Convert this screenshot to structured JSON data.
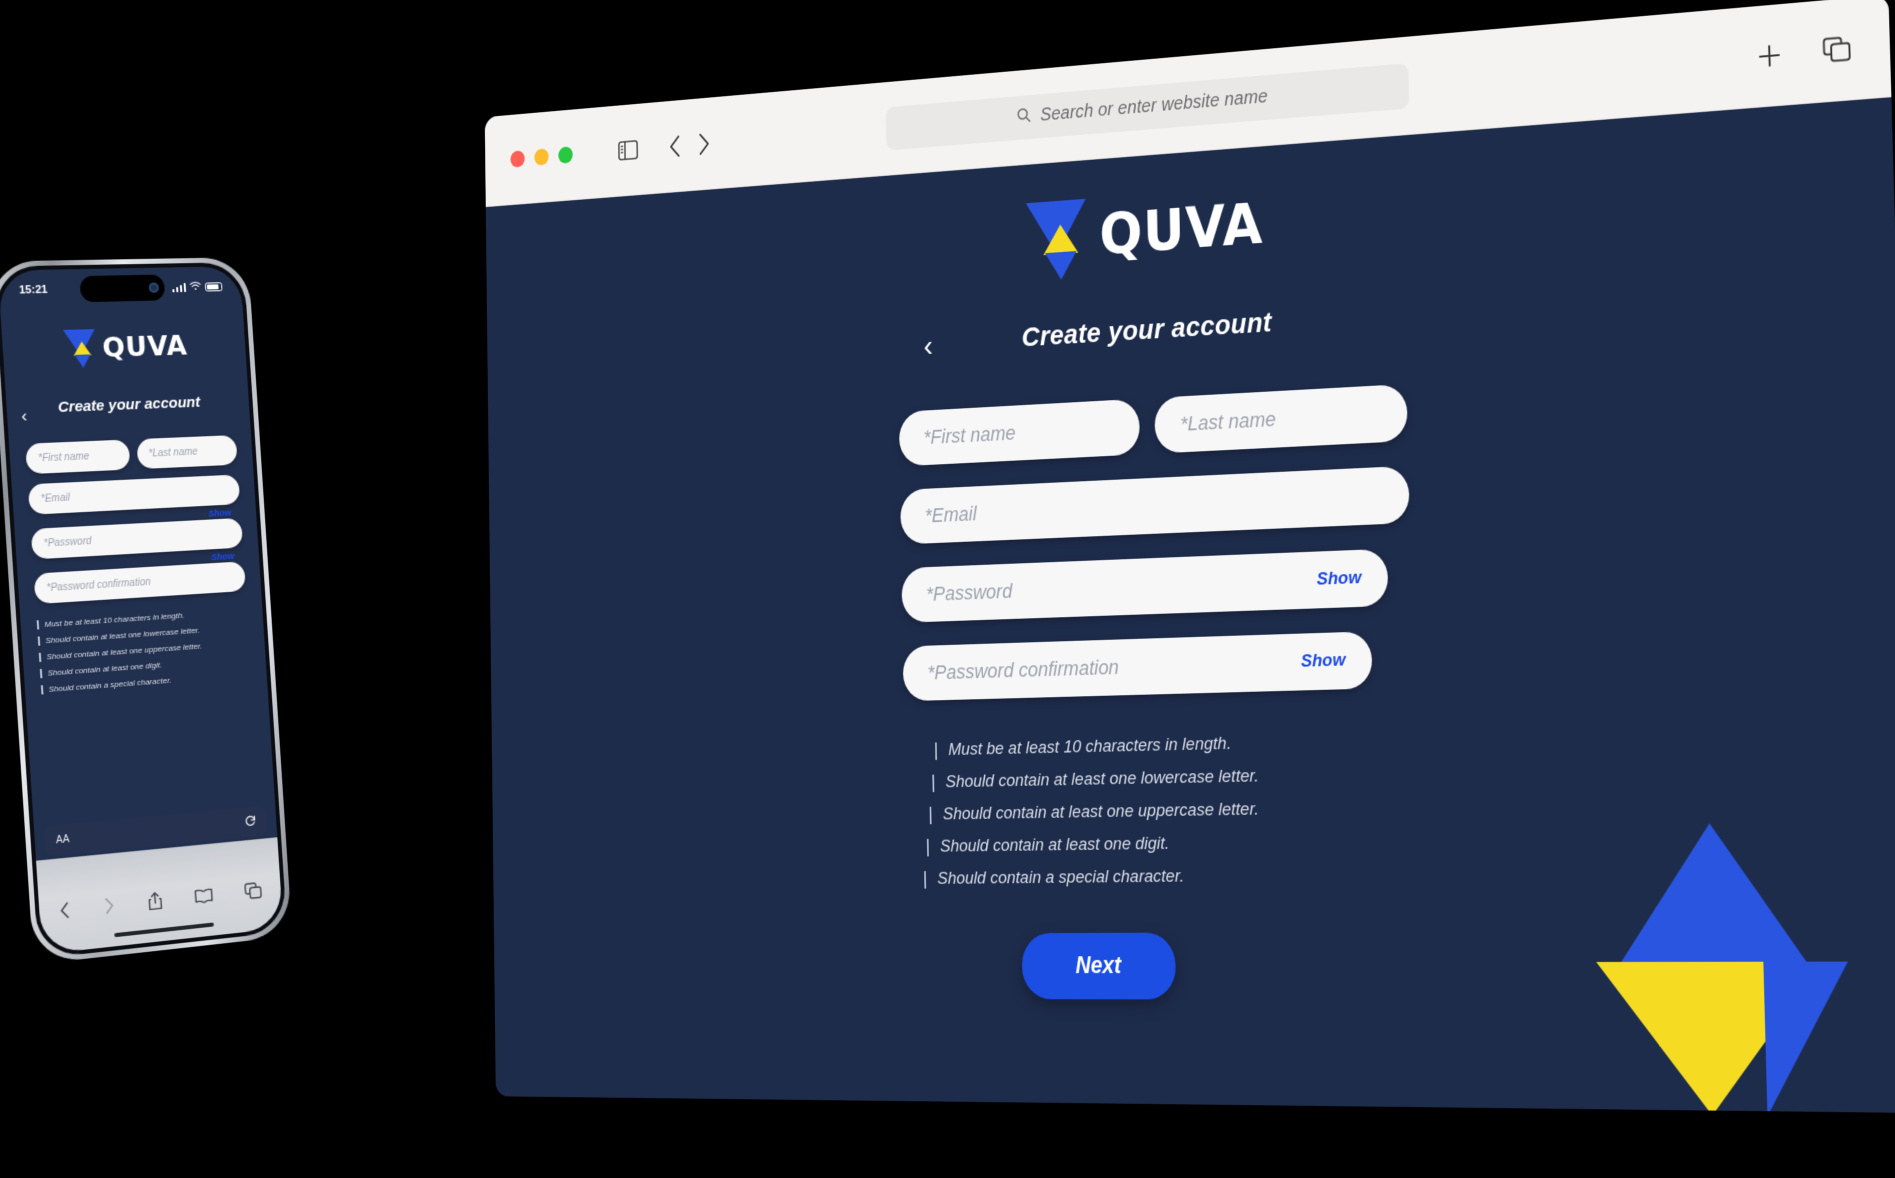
{
  "browser": {
    "window_controls": [
      "close",
      "minimize",
      "zoom"
    ],
    "sidebar_icon": "sidebar-toggle-icon",
    "back_icon": "chevron-left-icon",
    "forward_icon": "chevron-right-icon",
    "search": {
      "placeholder": "Search or enter website name",
      "icon": "search-icon"
    },
    "new_tab_icon": "plus-icon",
    "tab_overview_icon": "tab-overview-icon"
  },
  "brand": {
    "name": "QUVA",
    "logo_icon": "quva-triangle-logo",
    "colors": {
      "navy": "#1e2c4c",
      "blue": "#2a55e0",
      "yellow": "#f5dc22",
      "accent_link": "#1c49e8",
      "button": "#1d4ee4"
    }
  },
  "page": {
    "back_icon": "chevron-left-icon",
    "title": "Create your account",
    "fields": {
      "first_name": "*First name",
      "last_name": "*Last name",
      "email": "*Email",
      "password": "*Password",
      "password_confirmation": "*Password confirmation"
    },
    "show_label": "Show",
    "requirements": [
      "Must be at least 10 characters in length.",
      "Should contain at least one lowercase letter.",
      "Should contain at least one uppercase letter.",
      "Should contain at least one digit.",
      "Should contain a special character."
    ],
    "next_label": "Next"
  },
  "phone": {
    "status": {
      "time": "15:21",
      "signal_icon": "cellular-bars-icon",
      "wifi_icon": "wifi-icon",
      "battery_icon": "battery-icon"
    },
    "safari": {
      "text_size_label": "AA",
      "reload_icon": "reload-icon",
      "back_icon": "chevron-left-icon",
      "forward_icon": "chevron-right-icon",
      "share_icon": "share-icon",
      "bookmarks_icon": "book-icon",
      "tabs_icon": "tabs-icon"
    }
  }
}
